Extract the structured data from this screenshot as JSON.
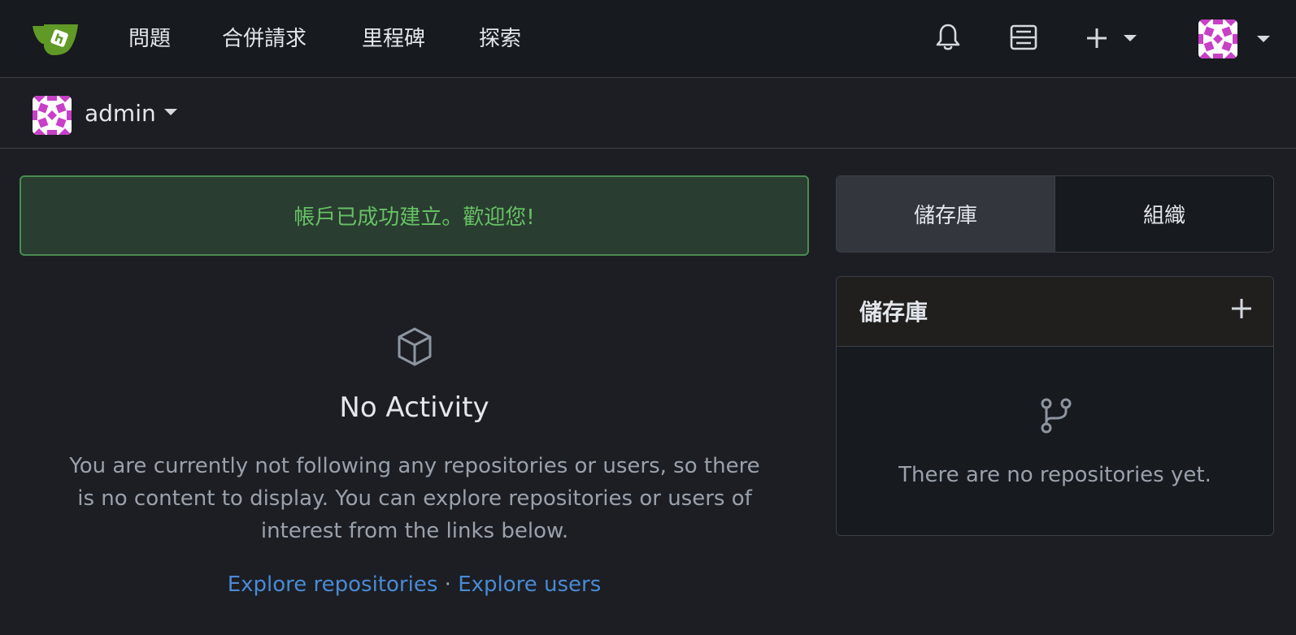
{
  "nav": {
    "items": [
      {
        "label": "問題"
      },
      {
        "label": "合併請求"
      },
      {
        "label": "里程碑"
      },
      {
        "label": "探索"
      }
    ]
  },
  "context": {
    "username": "admin"
  },
  "flash": {
    "message": "帳戶已成功建立。歡迎您!"
  },
  "feed": {
    "empty_title": "No Activity",
    "empty_description": "You are currently not following any repositories or users, so there is no content to display. You can explore repositories or users of interest from the links below.",
    "explore_repos_label": "Explore repositories",
    "separator": "·",
    "explore_users_label": "Explore users"
  },
  "sidebar": {
    "tabs": [
      {
        "label": "儲存庫",
        "active": true
      },
      {
        "label": "組織",
        "active": false
      }
    ],
    "repo_box_title": "儲存庫",
    "repo_empty_text": "There are no repositories yet."
  },
  "colors": {
    "background": "#1c1e24",
    "nav_background": "#171a1f",
    "success_text": "#66c264",
    "success_border": "#4a8c50",
    "link": "#4a8ad3",
    "muted": "#9aa1ab",
    "logo_green": "#609926"
  },
  "icons": {
    "logo": "gitea-logo",
    "notifications": "bell-icon",
    "stopwatch": "server-icon",
    "create": "plus-icon",
    "empty_feed": "package-icon",
    "empty_repos": "repo-forked-icon"
  }
}
